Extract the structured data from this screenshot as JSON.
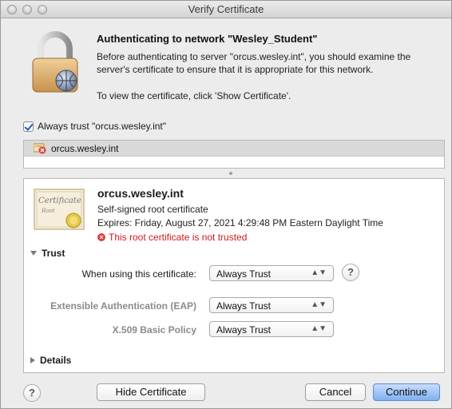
{
  "window": {
    "title": "Verify Certificate"
  },
  "header": {
    "heading": "Authenticating to network \"Wesley_Student\"",
    "paragraph": "Before authenticating to server \"orcus.wesley.int\", you should examine the server's certificate to ensure that it is appropriate for this network.",
    "paragraph2": "To view the certificate, click 'Show Certificate'."
  },
  "trust_checkbox": {
    "label": "Always trust \"orcus.wesley.int\"",
    "checked": true
  },
  "cert_list": {
    "items": [
      {
        "label": "orcus.wesley.int"
      }
    ]
  },
  "certificate": {
    "name": "orcus.wesley.int",
    "type": "Self-signed root certificate",
    "expires": "Expires: Friday, August 27, 2021 4:29:48 PM Eastern Daylight Time",
    "warning": "This root certificate is not trusted",
    "image_text_certificate": "Certificate",
    "image_text_root": "Root"
  },
  "trust_section": {
    "title": "Trust",
    "rows": [
      {
        "label": "When using this certificate:",
        "value": "Always Trust"
      },
      {
        "label": "Extensible Authentication (EAP)",
        "value": "Always Trust"
      },
      {
        "label": "X.509 Basic Policy",
        "value": "Always Trust"
      }
    ],
    "help": "?"
  },
  "details_section": {
    "title": "Details"
  },
  "footer": {
    "help": "?",
    "hide_certificate": "Hide Certificate",
    "cancel": "Cancel",
    "continue": "Continue"
  },
  "icons": [
    "padlock-icon",
    "certificate-error-icon",
    "certificate-icon",
    "error-x-icon",
    "disclosure-triangle-icon",
    "help-icon"
  ]
}
